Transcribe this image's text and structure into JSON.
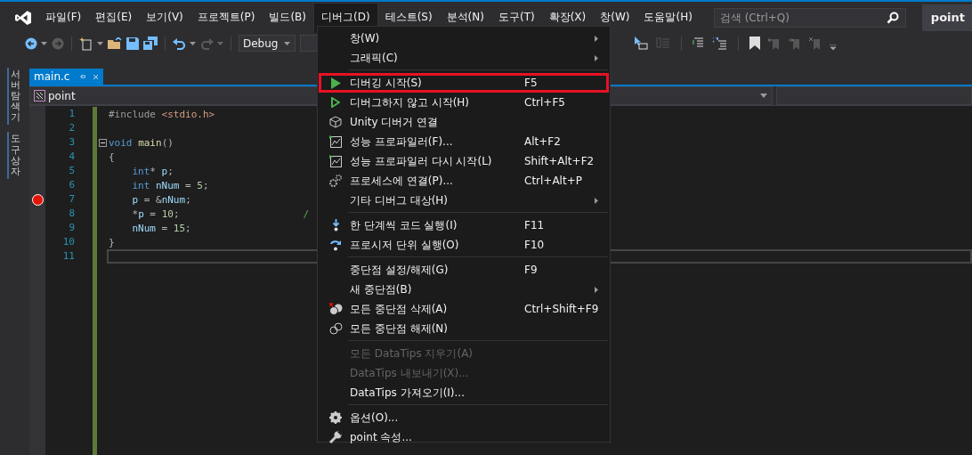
{
  "menu_bar": [
    {
      "label": "파일(F)",
      "selected": false
    },
    {
      "label": "편집(E)",
      "selected": false
    },
    {
      "label": "보기(V)",
      "selected": false
    },
    {
      "label": "프로젝트(P)",
      "selected": false
    },
    {
      "label": "빌드(B)",
      "selected": false
    },
    {
      "label": "디버그(D)",
      "selected": true
    },
    {
      "label": "테스트(S)",
      "selected": false
    },
    {
      "label": "분석(N)",
      "selected": false
    },
    {
      "label": "도구(T)",
      "selected": false
    },
    {
      "label": "확장(X)",
      "selected": false
    },
    {
      "label": "창(W)",
      "selected": false
    },
    {
      "label": "도움말(H)",
      "selected": false
    }
  ],
  "search": {
    "placeholder": "검색 (Ctrl+Q)"
  },
  "window_title": "point",
  "toolbar": {
    "configuration": "Debug"
  },
  "side_tabs": [
    "서버 탐색기",
    "도구 상자"
  ],
  "editor_tab": {
    "label": "main.c"
  },
  "navigation_bar": {
    "scope": "point"
  },
  "code": [
    {
      "number": "1",
      "breakpoint": false,
      "fold": false,
      "current": false,
      "tokens": [
        {
          "text": "#include ",
          "kind": "preproc"
        },
        {
          "text": "<stdio.h>",
          "kind": "string"
        }
      ]
    },
    {
      "number": "2",
      "breakpoint": false,
      "fold": false,
      "current": false
    },
    {
      "number": "3",
      "breakpoint": false,
      "fold": true,
      "current": false,
      "tokens": [
        {
          "text": "void ",
          "kind": "keyword"
        },
        {
          "text": "main",
          "kind": "function"
        },
        {
          "text": "()",
          "kind": "punct"
        }
      ]
    },
    {
      "number": "4",
      "breakpoint": false,
      "fold": false,
      "current": false,
      "tokens": [
        {
          "text": "{",
          "kind": "punct"
        }
      ]
    },
    {
      "number": "5",
      "breakpoint": false,
      "fold": false,
      "current": false,
      "tokens": [
        {
          "text": "    int",
          "kind": "keyword"
        },
        {
          "text": "* ",
          "kind": "punct"
        },
        {
          "text": "p",
          "kind": "variable"
        },
        {
          "text": ";",
          "kind": "punct"
        }
      ]
    },
    {
      "number": "6",
      "breakpoint": false,
      "fold": false,
      "current": false,
      "tokens": [
        {
          "text": "    int ",
          "kind": "keyword"
        },
        {
          "text": "nNum",
          "kind": "variable"
        },
        {
          "text": " = ",
          "kind": "punct"
        },
        {
          "text": "5",
          "kind": "number"
        },
        {
          "text": ";",
          "kind": "punct"
        }
      ]
    },
    {
      "number": "7",
      "breakpoint": true,
      "fold": false,
      "current": false,
      "tokens": [
        {
          "text": "    p",
          "kind": "variable"
        },
        {
          "text": " = &",
          "kind": "punct"
        },
        {
          "text": "nNum",
          "kind": "variable"
        },
        {
          "text": ";",
          "kind": "punct"
        }
      ]
    },
    {
      "number": "8",
      "breakpoint": false,
      "fold": false,
      "current": false,
      "tokens": [
        {
          "text": "    *",
          "kind": "punct"
        },
        {
          "text": "p",
          "kind": "variable"
        },
        {
          "text": " = ",
          "kind": "punct"
        },
        {
          "text": "10",
          "kind": "number"
        },
        {
          "text": ";                     ",
          "kind": "punct"
        },
        {
          "text": "/",
          "kind": "comment"
        }
      ]
    },
    {
      "number": "9",
      "breakpoint": false,
      "fold": false,
      "current": false,
      "tokens": [
        {
          "text": "    nNum",
          "kind": "variable"
        },
        {
          "text": " = ",
          "kind": "punct"
        },
        {
          "text": "15",
          "kind": "number"
        },
        {
          "text": ";",
          "kind": "punct"
        }
      ]
    },
    {
      "number": "10",
      "breakpoint": false,
      "fold": false,
      "current": false,
      "tokens": [
        {
          "text": "}",
          "kind": "punct"
        }
      ]
    },
    {
      "number": "11",
      "breakpoint": false,
      "fold": false,
      "current": true
    }
  ],
  "debug_menu": [
    {
      "kind": "item",
      "label": "창(W)",
      "submenu": true,
      "disabled": false,
      "highlighted": false
    },
    {
      "kind": "item",
      "label": "그래픽(C)",
      "submenu": true,
      "disabled": false,
      "highlighted": false
    },
    {
      "kind": "separator"
    },
    {
      "kind": "item",
      "label": "디버깅 시작(S)",
      "shortcut": "F5",
      "submenu": false,
      "disabled": false,
      "highlighted": true
    },
    {
      "kind": "item",
      "label": "디버그하지 않고 시작(H)",
      "shortcut": "Ctrl+F5",
      "submenu": false,
      "disabled": false,
      "highlighted": false
    },
    {
      "kind": "item",
      "label": "Unity 디버거 연결",
      "submenu": false,
      "disabled": false,
      "highlighted": false
    },
    {
      "kind": "item",
      "label": "성능 프로파일러(F)...",
      "shortcut": "Alt+F2",
      "submenu": false,
      "disabled": false,
      "highlighted": false
    },
    {
      "kind": "item",
      "label": "성능 프로파일러 다시 시작(L)",
      "shortcut": "Shift+Alt+F2",
      "submenu": false,
      "disabled": false,
      "highlighted": false
    },
    {
      "kind": "item",
      "label": "프로세스에 연결(P)...",
      "shortcut": "Ctrl+Alt+P",
      "submenu": false,
      "disabled": false,
      "highlighted": false
    },
    {
      "kind": "item",
      "label": "기타 디버그 대상(H)",
      "submenu": true,
      "disabled": false,
      "highlighted": false
    },
    {
      "kind": "separator"
    },
    {
      "kind": "item",
      "label": "한 단계씩 코드 실행(I)",
      "shortcut": "F11",
      "submenu": false,
      "disabled": false,
      "highlighted": false
    },
    {
      "kind": "item",
      "label": "프로시저 단위 실행(O)",
      "shortcut": "F10",
      "submenu": false,
      "disabled": false,
      "highlighted": false
    },
    {
      "kind": "separator"
    },
    {
      "kind": "item",
      "label": "중단점 설정/해제(G)",
      "shortcut": "F9",
      "submenu": false,
      "disabled": false,
      "highlighted": false
    },
    {
      "kind": "item",
      "label": "새 중단점(B)",
      "submenu": true,
      "disabled": false,
      "highlighted": false
    },
    {
      "kind": "item",
      "label": "모든 중단점 삭제(A)",
      "shortcut": "Ctrl+Shift+F9",
      "submenu": false,
      "disabled": false,
      "highlighted": false
    },
    {
      "kind": "item",
      "label": "모든 중단점 해제(N)",
      "submenu": false,
      "disabled": false,
      "highlighted": false
    },
    {
      "kind": "separator"
    },
    {
      "kind": "item",
      "label": "모든 DataTips 지우기(A)",
      "submenu": false,
      "disabled": true,
      "highlighted": false
    },
    {
      "kind": "item",
      "label": "DataTips 내보내기(X)...",
      "submenu": false,
      "disabled": true,
      "highlighted": false
    },
    {
      "kind": "item",
      "label": "DataTips 가져오기(I)...",
      "submenu": false,
      "disabled": false,
      "highlighted": false
    },
    {
      "kind": "separator"
    },
    {
      "kind": "item",
      "label": "옵션(O)...",
      "submenu": false,
      "disabled": false,
      "highlighted": false
    },
    {
      "kind": "item",
      "label": "point 속성...",
      "submenu": false,
      "disabled": false,
      "highlighted": false
    }
  ]
}
